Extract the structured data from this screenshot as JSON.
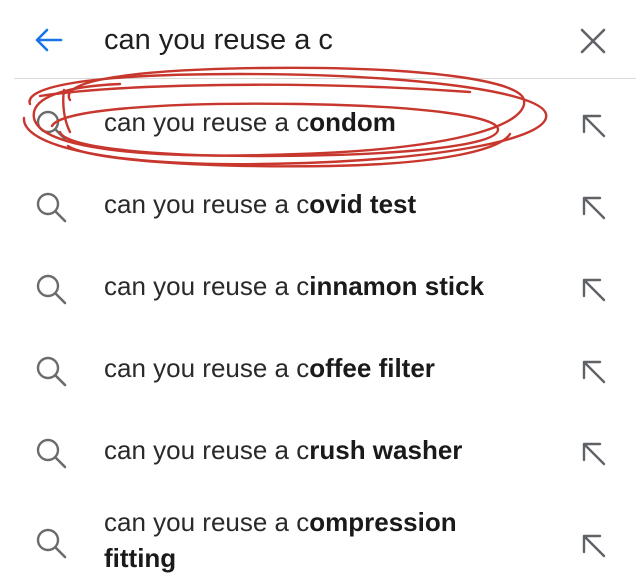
{
  "search": {
    "query": "can you reuse a c",
    "back_icon": "arrow-left-icon",
    "clear_icon": "close-icon"
  },
  "suggestions": [
    {
      "prefix": "can you reuse a c",
      "completion": "ondom",
      "extra": ""
    },
    {
      "prefix": "can you reuse a c",
      "completion": "ovid test",
      "extra": ""
    },
    {
      "prefix": "can you reuse a c",
      "completion": "innamon stick",
      "extra": ""
    },
    {
      "prefix": "can you reuse a c",
      "completion": "offee filter",
      "extra": ""
    },
    {
      "prefix": "can you reuse a c",
      "completion": "rush washer",
      "extra": ""
    },
    {
      "prefix": "can you reuse a c",
      "completion": "ompression",
      "extra": "fitting"
    }
  ],
  "colors": {
    "accent": "#1a73e8",
    "scribble": "#c8372d",
    "icon_gray": "#6b6b6b"
  }
}
